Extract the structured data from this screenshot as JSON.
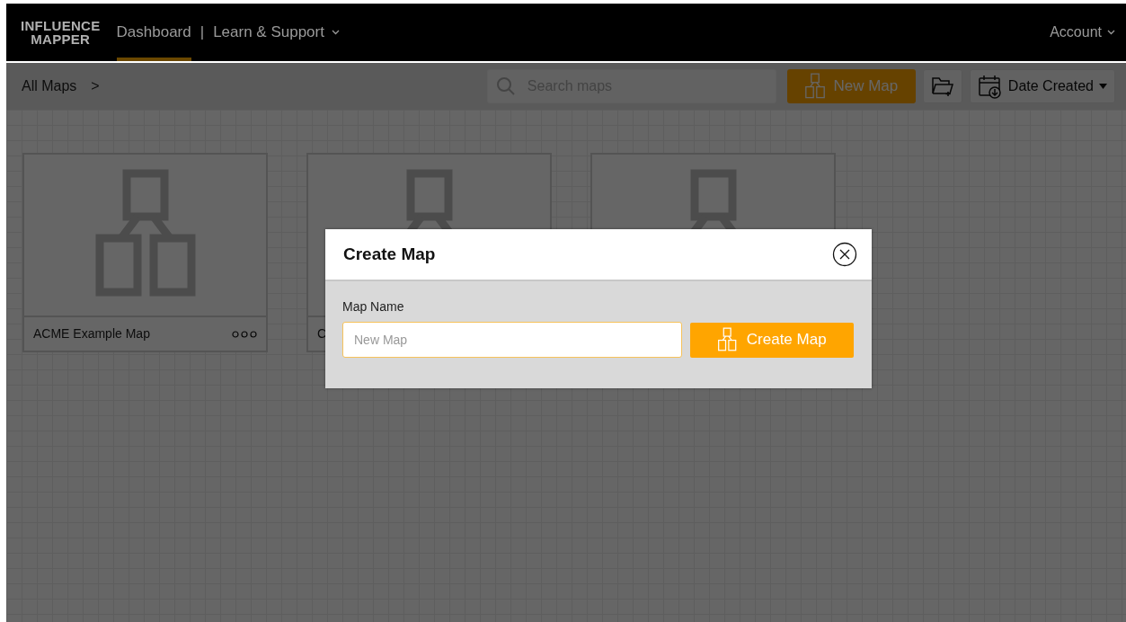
{
  "navbar": {
    "logo": [
      "INFLUENCE",
      "MAPPER"
    ],
    "links": [
      {
        "label": "Dashboard",
        "selected": true,
        "has_menu": false
      },
      {
        "label": "Learn & Support",
        "selected": false,
        "has_menu": true
      }
    ],
    "separator": "|",
    "account": {
      "label": "Account",
      "has_menu": true
    }
  },
  "toolbar": {
    "breadcrumb": "All Maps",
    "breadcrumb_separator": ">",
    "search": {
      "placeholder": "Search maps"
    },
    "new_map_button": "New Map",
    "sort_button": "Date Created"
  },
  "maps": [
    {
      "title": "ACME Example Map",
      "menu": true
    },
    {
      "title": "C",
      "menu": false
    },
    {
      "menu": false
    }
  ],
  "modal": {
    "title": "Create Map",
    "field_label": "Map Name",
    "field": {
      "placeholder": "New Map"
    },
    "submit_button": "Create Map"
  }
}
